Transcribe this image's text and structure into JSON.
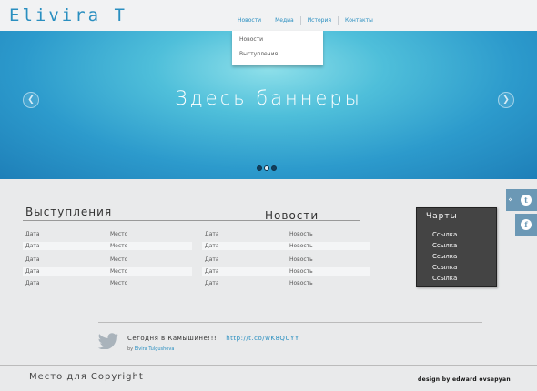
{
  "header": {
    "logo": "Elivira T",
    "nav": [
      "Новости",
      "Медиа",
      "История",
      "Контакты"
    ]
  },
  "dropdown": {
    "items": [
      "Новости",
      "Выступления"
    ]
  },
  "banner": {
    "text": "Здесь баннеры",
    "slide_count": 3,
    "active_slide": 2
  },
  "performances": {
    "title": "Выступления",
    "rows": [
      {
        "date": "Дата",
        "place": "Место"
      },
      {
        "date": "Дата",
        "place": "Место"
      },
      {
        "date": "Дата",
        "place": "Место"
      },
      {
        "date": "Дата",
        "place": "Место"
      },
      {
        "date": "Дата",
        "place": "Место"
      }
    ]
  },
  "news": {
    "title": "Новости",
    "rows": [
      {
        "date": "Дата",
        "text": "Новость"
      },
      {
        "date": "Дата",
        "text": "Новость"
      },
      {
        "date": "Дата",
        "text": "Новость"
      },
      {
        "date": "Дата",
        "text": "Новость"
      },
      {
        "date": "Дата",
        "text": "Новость"
      }
    ]
  },
  "charts": {
    "title": "Чарты",
    "links": [
      "Ссылка",
      "Ссылка",
      "Ссылка",
      "Ссылка",
      "Ссылка"
    ]
  },
  "social": {
    "collapse": "«",
    "twitter_letter": "t",
    "facebook_letter": "f"
  },
  "tweet": {
    "text": "Сегодня в Камышине!!!!",
    "link": "http://t.co/wK8QUYY",
    "by_label": "by",
    "author": "Elvira Tulgusheva"
  },
  "footer": {
    "copyright": "Место для Copyright",
    "design_by": "design by edward ovsepyan"
  },
  "colors": {
    "accent": "#2a8fc0",
    "banner": "#2c9acc",
    "charts_bg": "#444444",
    "social": "#6b98b5"
  }
}
